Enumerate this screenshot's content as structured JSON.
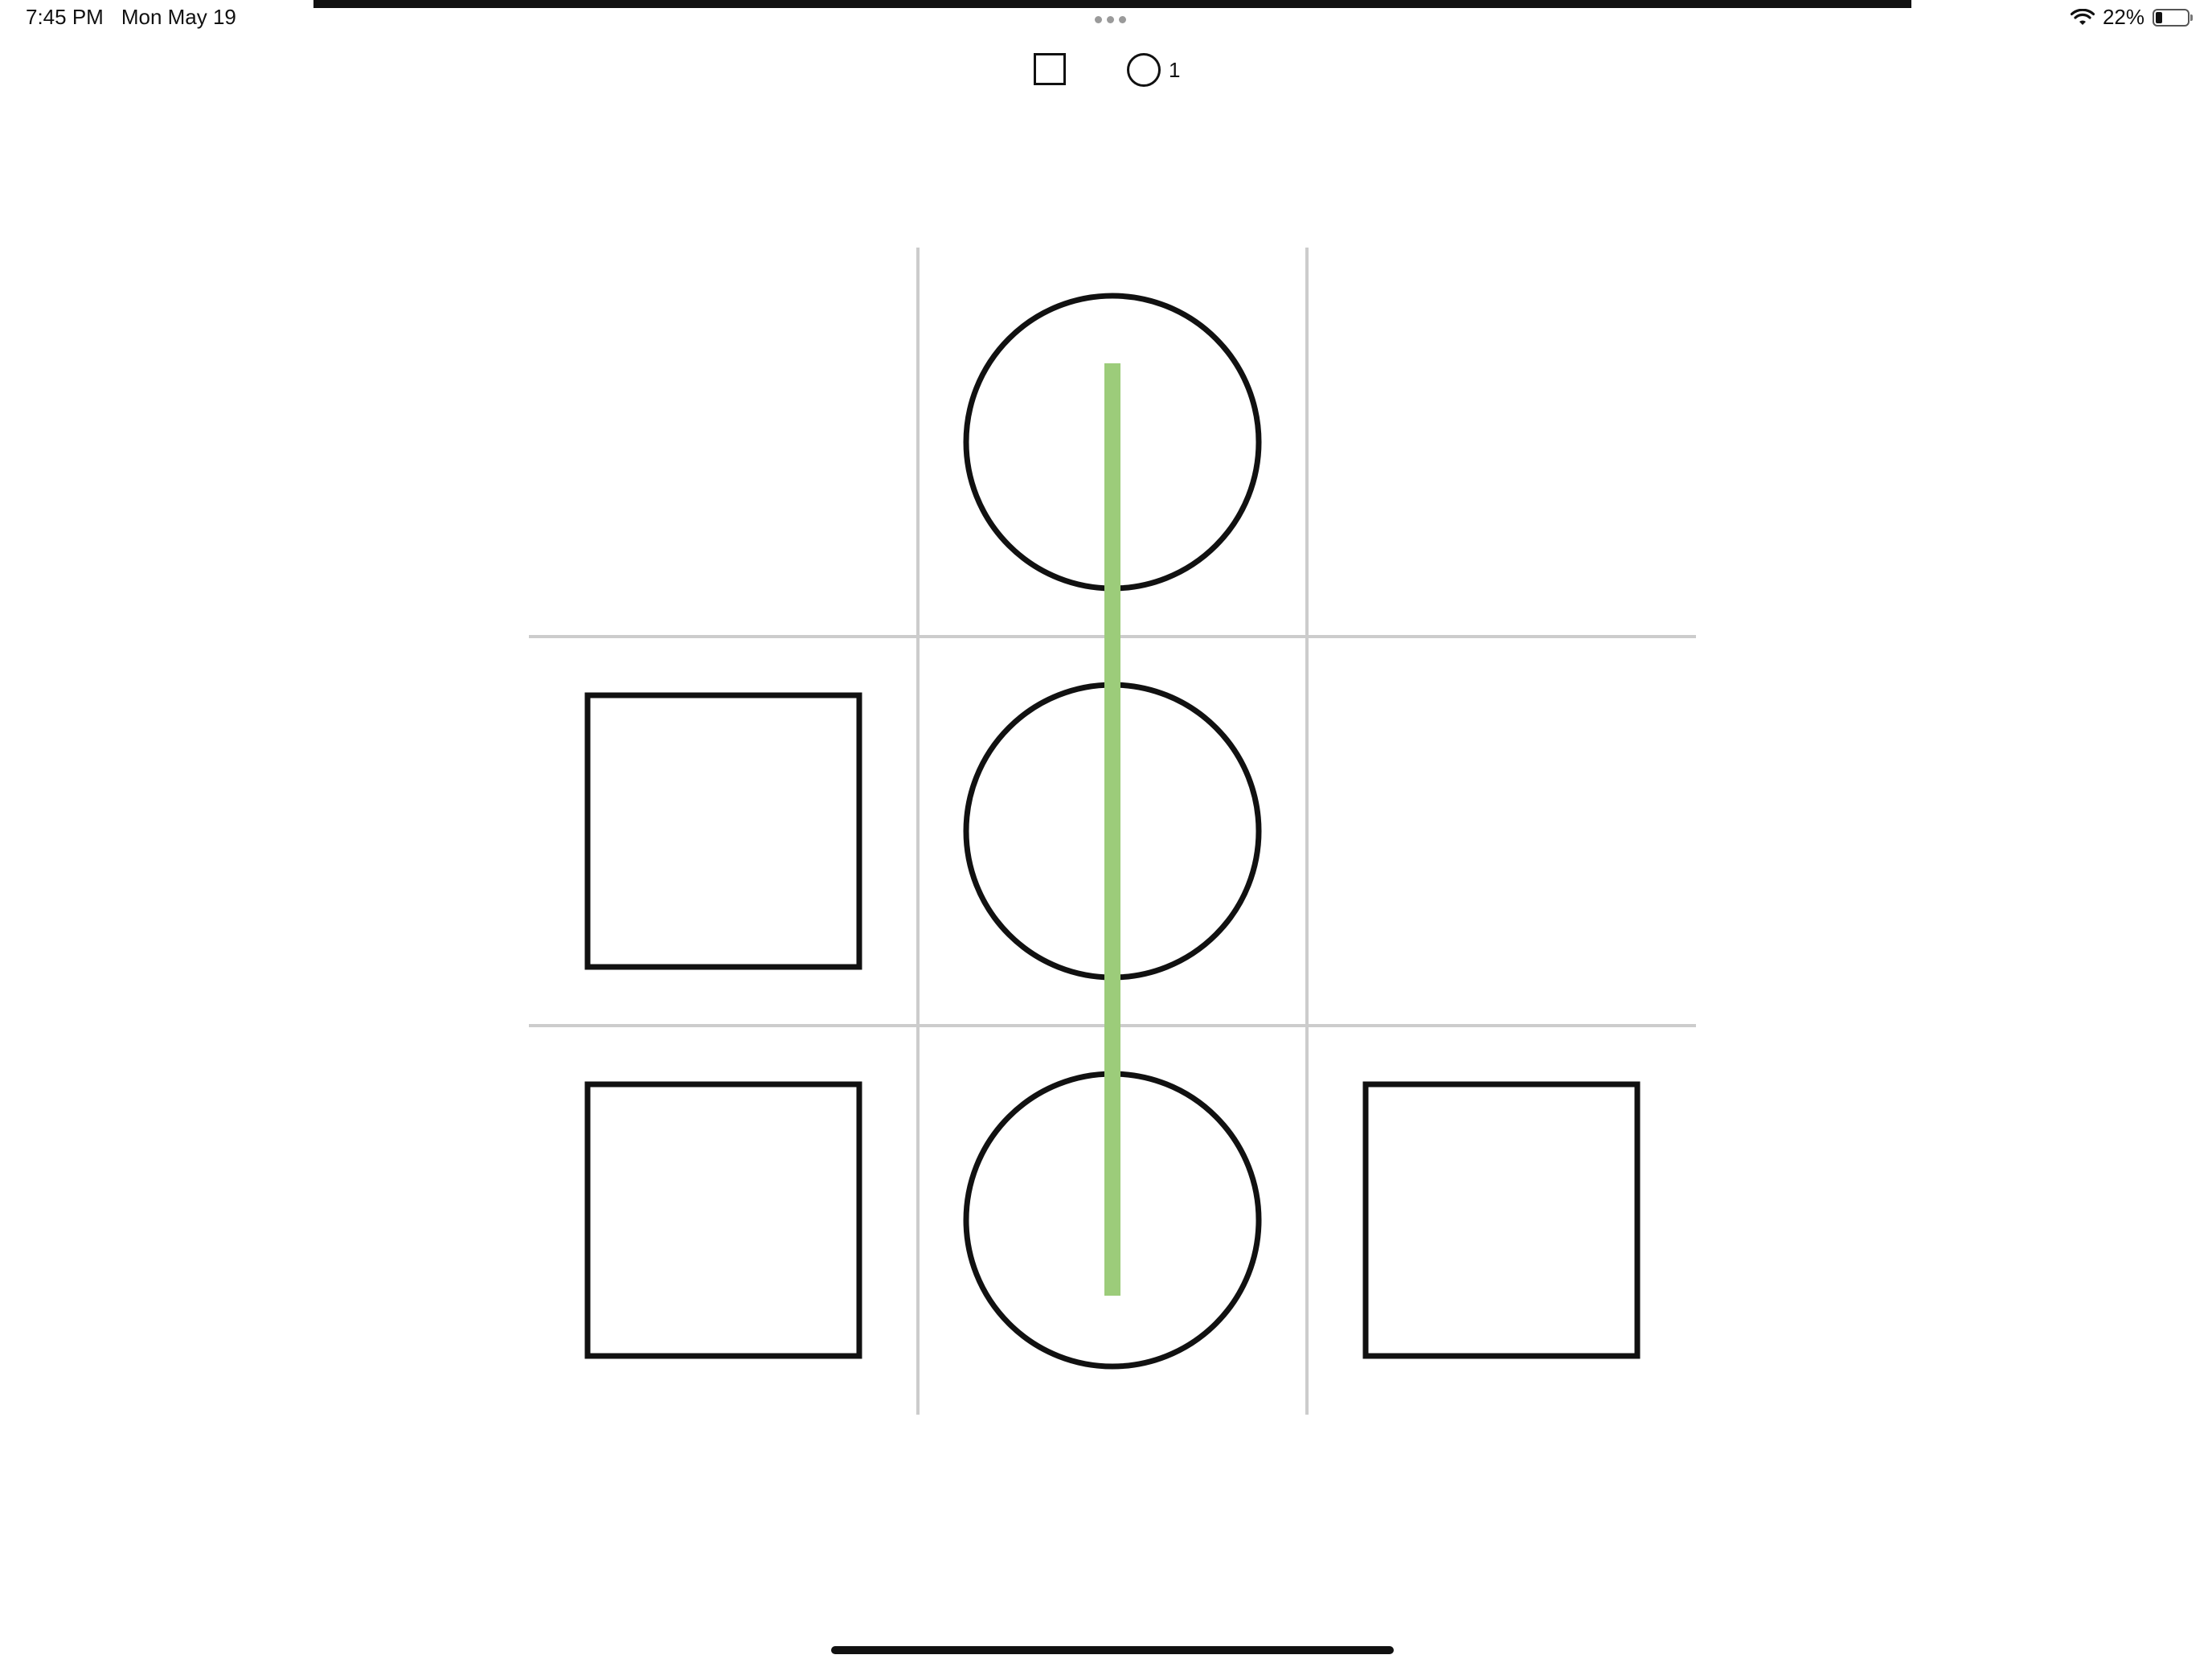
{
  "status_bar": {
    "time": "7:45 PM",
    "date": "Mon May 19",
    "battery": "22%",
    "battery_level": 0.22,
    "icons": [
      "wifi-icon",
      "battery-icon"
    ]
  },
  "score": {
    "square_icon": "square-icon",
    "square_count": "",
    "circle_icon": "circle-icon",
    "circle_count": "1"
  },
  "board": {
    "rows": 3,
    "cols": 3,
    "cells": [
      [
        "",
        "O",
        ""
      ],
      [
        "X",
        "O",
        ""
      ],
      [
        "X",
        "O",
        "X"
      ]
    ],
    "symbols": {
      "X": "square",
      "O": "circle"
    },
    "winning_line": {
      "orientation": "vertical",
      "col": 1
    },
    "colors": {
      "grid": "#cccccc",
      "piece": "#111111",
      "win_line": "#9ccc7a"
    }
  }
}
